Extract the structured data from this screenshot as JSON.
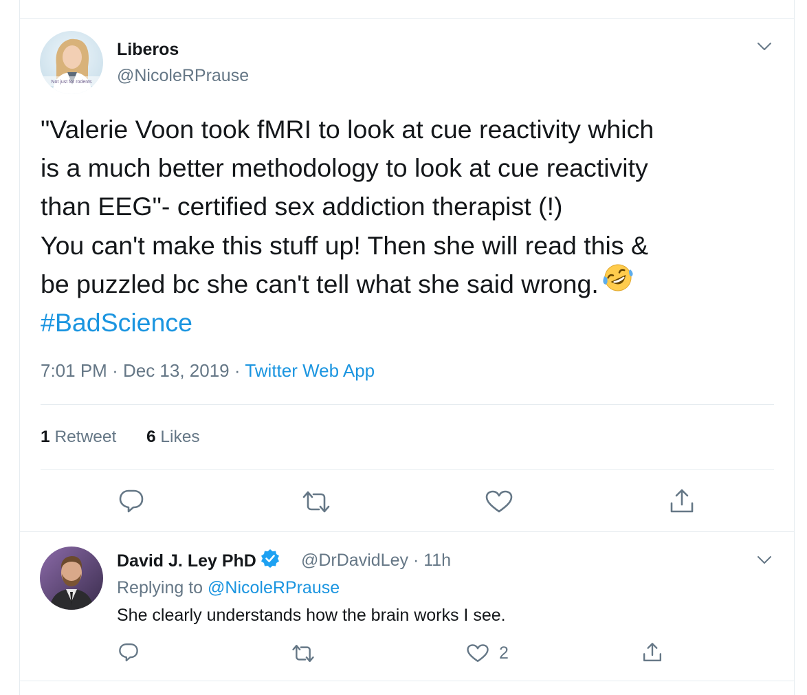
{
  "main_tweet": {
    "author_name": "Liberos",
    "author_handle": "@NicoleRPrause",
    "avatar_caption": "Not just for rodents",
    "text_lines": [
      "\"Valerie Voon took fMRI to look at cue reactivity which",
      "is a much better methodology to look at cue reactivity",
      "than EEG\"- certified sex addiction therapist (!)",
      "You can't make this stuff up! Then she will read this &",
      "be puzzled bc she can't tell what she said wrong."
    ],
    "emoji": "rolling-on-floor-laughing-emoji",
    "hashtag": "#BadScience",
    "time": "7:01 PM",
    "date": "Dec 13, 2019",
    "separator": "·",
    "source": "Twitter Web App",
    "retweet_count": "1",
    "retweet_label": "Retweet",
    "like_count": "6",
    "like_label": "Likes",
    "icons": [
      "reply-icon",
      "retweet-icon",
      "like-icon",
      "share-icon"
    ]
  },
  "reply_tweet": {
    "author_name": "David J. Ley PhD",
    "author_handle": "@DrDavidLey",
    "separator": "·",
    "time_ago": "11h",
    "replying_prefix": "Replying to",
    "replying_to": "@NicoleRPrause",
    "text": "She clearly understands how the brain works I see.",
    "like_count": "2",
    "icons": [
      "reply-icon",
      "retweet-icon",
      "like-icon",
      "share-icon"
    ]
  },
  "colors": {
    "text": "#14171a",
    "secondary": "#657786",
    "link": "#1b95e0",
    "divider": "#e6ecf0",
    "verified": "#1da1f2"
  }
}
